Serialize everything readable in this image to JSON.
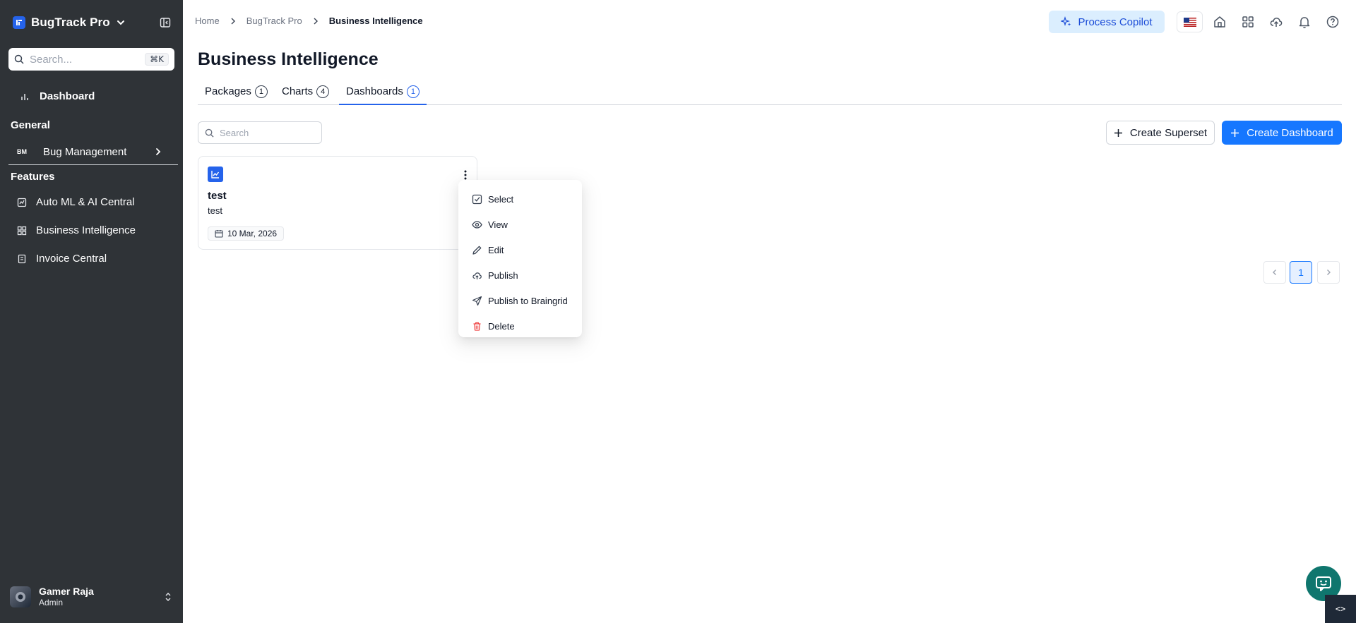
{
  "sidebar": {
    "brand": "BugTrack Pro",
    "search_placeholder": "Search...",
    "search_shortcut": "⌘K",
    "dashboard_label": "Dashboard",
    "general_label": "General",
    "bug_management": {
      "badge": "BM",
      "label": "Bug Management"
    },
    "features_label": "Features",
    "features": [
      {
        "label": "Auto ML & AI Central",
        "icon": "automl-icon"
      },
      {
        "label": "Business Intelligence",
        "icon": "bi-grid-icon"
      },
      {
        "label": "Invoice Central",
        "icon": "invoice-icon"
      }
    ],
    "user": {
      "name": "Gamer Raja",
      "role": "Admin"
    }
  },
  "header": {
    "breadcrumb": [
      "Home",
      "BugTrack Pro",
      "Business Intelligence"
    ],
    "copilot_label": "Process Copilot",
    "icons": [
      "flag-us-icon",
      "home-icon",
      "apps-grid-icon",
      "cloud-upload-icon",
      "bell-icon",
      "help-icon"
    ]
  },
  "page": {
    "title": "Business Intelligence",
    "tabs": [
      {
        "label": "Packages",
        "count": "1"
      },
      {
        "label": "Charts",
        "count": "4"
      },
      {
        "label": "Dashboards",
        "count": "1"
      }
    ],
    "active_tab": "Dashboards",
    "search_placeholder": "Search",
    "create_superset_label": "Create Superset",
    "create_dashboard_label": "Create Dashboard"
  },
  "cards": [
    {
      "title": "test",
      "subtitle": "test",
      "date": "10 Mar, 2026"
    }
  ],
  "context_menu": {
    "items": [
      {
        "label": "Select",
        "icon": "checkbox-icon"
      },
      {
        "label": "View",
        "icon": "eye-icon"
      },
      {
        "label": "Edit",
        "icon": "pencil-icon"
      },
      {
        "label": "Publish",
        "icon": "cloud-upload-icon"
      },
      {
        "label": "Publish to Braingrid",
        "icon": "send-icon"
      },
      {
        "label": "Delete",
        "icon": "trash-icon",
        "color": "#ef4444"
      }
    ]
  },
  "pagination": {
    "current": "1"
  },
  "colors": {
    "sidebar_bg": "#2f3337",
    "primary": "#1677ff",
    "copilot_bg": "#dbeefe",
    "copilot_text": "#1d4ed8",
    "danger": "#ef4444"
  },
  "dev_toggle": "<>"
}
